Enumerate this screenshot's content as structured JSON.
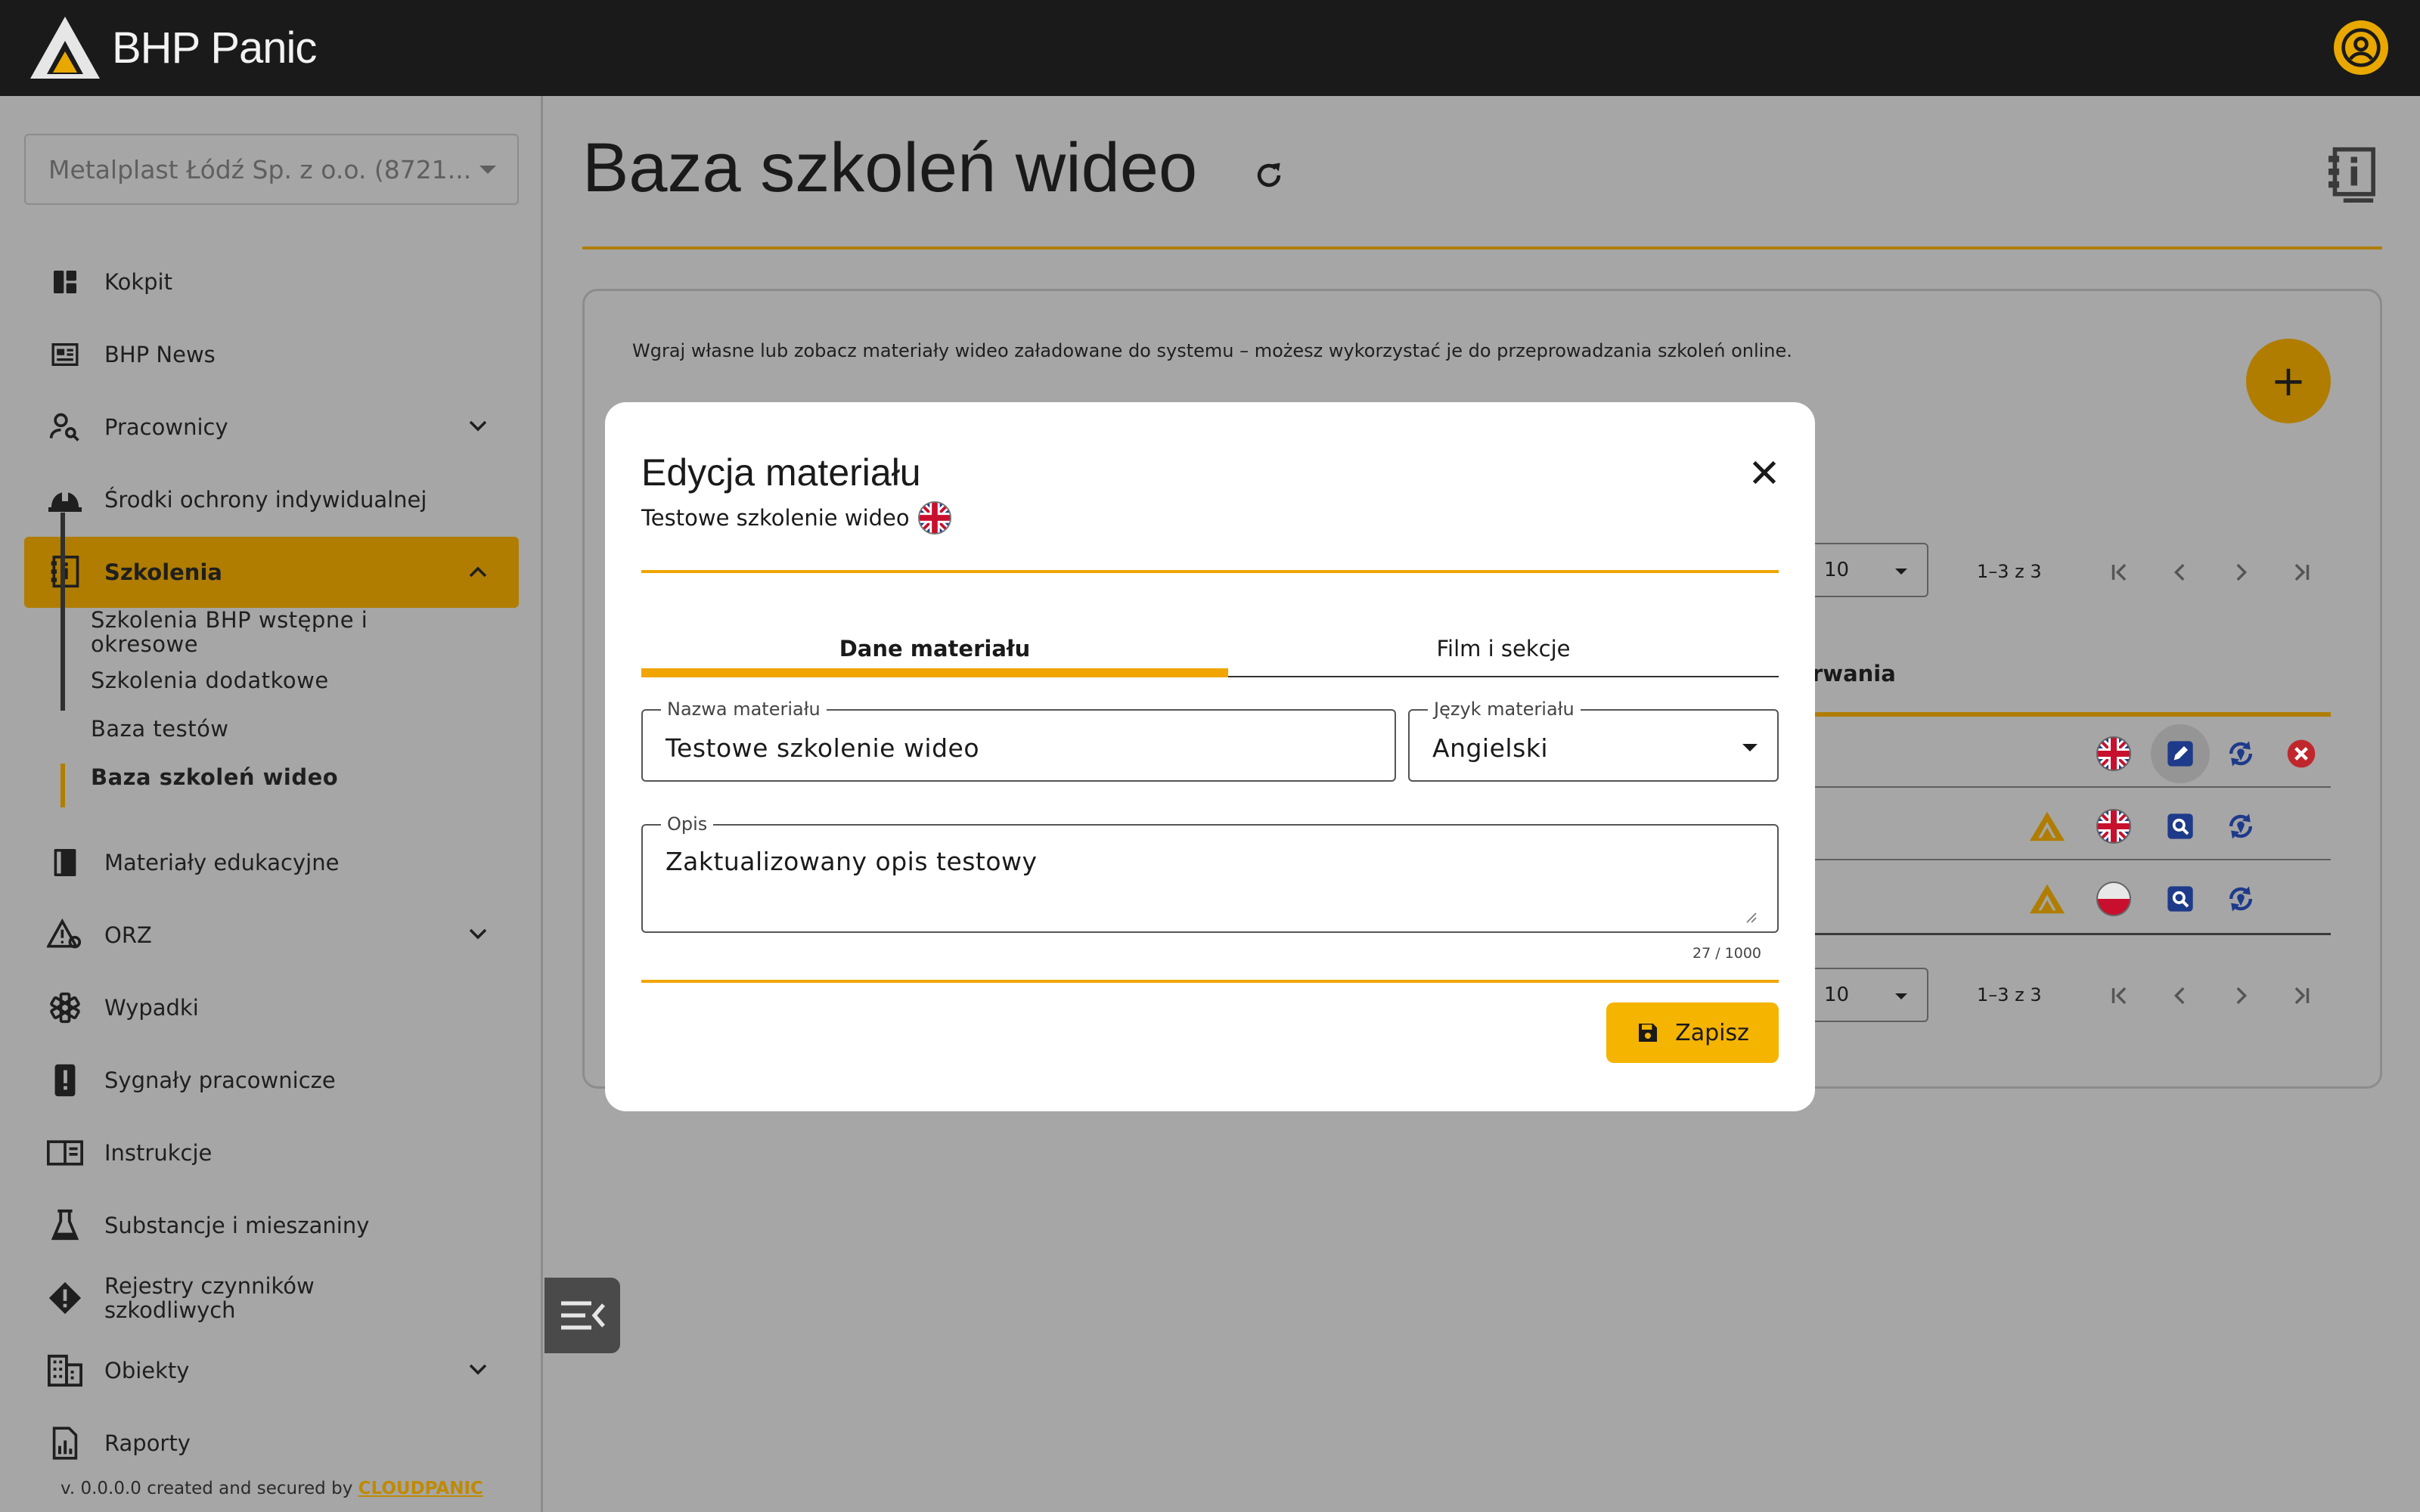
{
  "app": {
    "brand": "BHP Panic",
    "brand_color": "#e8a800"
  },
  "company_select": {
    "value": "Metalplast Łódź Sp. z o.o. (8721..."
  },
  "sidebar": {
    "items": [
      {
        "label": "Kokpit",
        "icon": "dashboard-icon"
      },
      {
        "label": "BHP News",
        "icon": "news-icon"
      },
      {
        "label": "Pracownicy",
        "icon": "user-search-icon"
      },
      {
        "label": "Środki ochrony indywidualnej",
        "icon": "helmet-icon"
      },
      {
        "label": "Szkolenia",
        "icon": "training-book-icon"
      },
      {
        "label": "Materiały edukacyjne",
        "icon": "book-icon"
      },
      {
        "label": "ORZ",
        "icon": "risk-warning-icon"
      },
      {
        "label": "Wypadki",
        "icon": "medical-star-icon"
      },
      {
        "label": "Sygnały pracownicze",
        "icon": "signal-alert-icon"
      },
      {
        "label": "Instrukcje",
        "icon": "instructions-icon"
      },
      {
        "label": "Substancje i mieszaniny",
        "icon": "flask-icon"
      },
      {
        "label": "Rejestry czynników szkodliwych",
        "icon": "hazard-diamond-icon"
      },
      {
        "label": "Obiekty",
        "icon": "building-icon"
      },
      {
        "label": "Raporty",
        "icon": "report-icon"
      }
    ],
    "sub_items": [
      {
        "label": "Szkolenia BHP wstępne i okresowe"
      },
      {
        "label": "Szkolenia dodatkowe"
      },
      {
        "label": "Baza testów"
      },
      {
        "label": "Baza szkoleń wideo"
      }
    ],
    "footer_prefix": "v. 0.0.0.0 created and secured by ",
    "footer_brand": "CLOUDPANIC"
  },
  "main": {
    "title": "Baza szkoleń wideo",
    "description": "Wgraj własne lub zobacz materiały wideo załadowane do systemu – możesz wykorzystać je do przeprowadzania szkoleń online.",
    "fab_label": "+",
    "page_size": "10",
    "range": "1–3 z 3",
    "column_header_partial": "rwania"
  },
  "modal": {
    "title": "Edycja materiału",
    "subtitle": "Testowe szkolenie wideo",
    "tabs": [
      {
        "label": "Dane materiału"
      },
      {
        "label": "Film i sekcje"
      }
    ],
    "name_field": {
      "label": "Nazwa materiału",
      "value": "Testowe szkolenie wideo"
    },
    "language_field": {
      "label": "Język materiału",
      "value": "Angielski"
    },
    "description_field": {
      "label": "Opis",
      "value": "Zaktualizowany opis testowy"
    },
    "counter": "27 / 1000",
    "save_label": "Zapisz"
  }
}
